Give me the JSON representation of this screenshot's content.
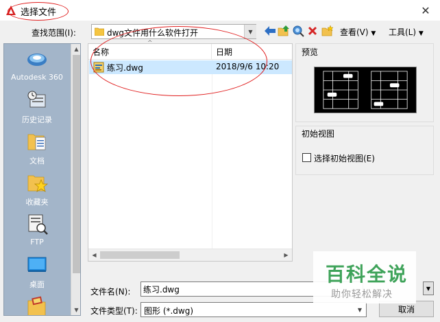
{
  "window": {
    "title": "选择文件",
    "close_glyph": "✕",
    "icon": "autocad-logo-icon",
    "accent_color": "#d51f1f"
  },
  "toolbar": {
    "lookin_label": "查找范围(I):",
    "lookin_value": "dwg文件用什么软件打开",
    "view_label": "查看(V)",
    "tools_label": "工具(L)",
    "icons": [
      "back-arrow-icon",
      "up-folder-icon",
      "search-web-icon",
      "delete-icon",
      "new-folder-icon"
    ]
  },
  "places": [
    {
      "label": "Autodesk 360",
      "icon": "autodesk-360-icon"
    },
    {
      "label": "历史记录",
      "icon": "history-icon"
    },
    {
      "label": "文档",
      "icon": "documents-icon"
    },
    {
      "label": "收藏夹",
      "icon": "favorites-icon"
    },
    {
      "label": "FTP",
      "icon": "ftp-icon"
    },
    {
      "label": "桌面",
      "icon": "desktop-icon"
    },
    {
      "label": "",
      "icon": "buzzsaw-icon"
    }
  ],
  "filelist": {
    "columns": [
      "名称",
      "日期"
    ],
    "rows": [
      {
        "name": "练习.dwg",
        "date": "2018/9/6 10:20",
        "icon": "dwg-file-icon",
        "selected": true
      }
    ]
  },
  "preview": {
    "label": "预览"
  },
  "initial_view": {
    "group_label": "初始视图",
    "checkbox_label": "选择初始视图(E)",
    "checked": false
  },
  "fields": {
    "filename_label": "文件名(N):",
    "filename_value": "练习.dwg",
    "filetype_label": "文件类型(T):",
    "filetype_value": "图形 (*.dwg)"
  },
  "buttons": {
    "cancel_label": "取消"
  },
  "watermark": {
    "title": "百科全说",
    "subtitle": "助你轻松解决"
  },
  "annotation_color": "#e01e1e"
}
